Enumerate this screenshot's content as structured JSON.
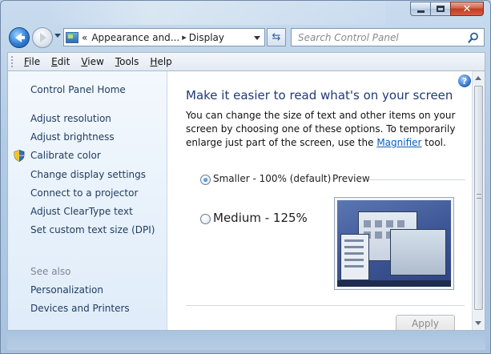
{
  "window": {
    "caption": {
      "minimize": "",
      "maximize": "",
      "close": "✕"
    }
  },
  "nav": {
    "breadcrumb": {
      "prefix": "«",
      "items": [
        "Appearance and...",
        "Display"
      ],
      "separator": "▸"
    },
    "refresh_glyph": "⇆",
    "search": {
      "placeholder": "Search Control Panel"
    }
  },
  "menu": {
    "items": [
      {
        "label": "File",
        "accel": "F"
      },
      {
        "label": "Edit",
        "accel": "E"
      },
      {
        "label": "View",
        "accel": "V"
      },
      {
        "label": "Tools",
        "accel": "T"
      },
      {
        "label": "Help",
        "accel": "H"
      }
    ]
  },
  "sidebar": {
    "home": "Control Panel Home",
    "tasks": [
      "Adjust resolution",
      "Adjust brightness",
      "Calibrate color",
      "Change display settings",
      "Connect to a projector",
      "Adjust ClearType text",
      "Set custom text size (DPI)"
    ],
    "see_also_heading": "See also",
    "see_also": [
      "Personalization",
      "Devices and Printers"
    ]
  },
  "main": {
    "help_glyph": "?",
    "title": "Make it easier to read what's on your screen",
    "description_before": "You can change the size of text and other items on your screen by choosing one of these options. To temporarily enlarge just part of the screen, use the ",
    "description_link": "Magnifier",
    "description_after": " tool.",
    "options": [
      {
        "label": "Smaller - 100% (default)",
        "checked": true
      },
      {
        "label": "Medium - 125%",
        "checked": false
      }
    ],
    "preview_label": "Preview",
    "apply_label": "Apply",
    "apply_enabled": false
  },
  "colors": {
    "title_blue": "#1e3a78",
    "link_blue": "#0b5cbd",
    "sidebar_bg": "#e6f0fa"
  }
}
